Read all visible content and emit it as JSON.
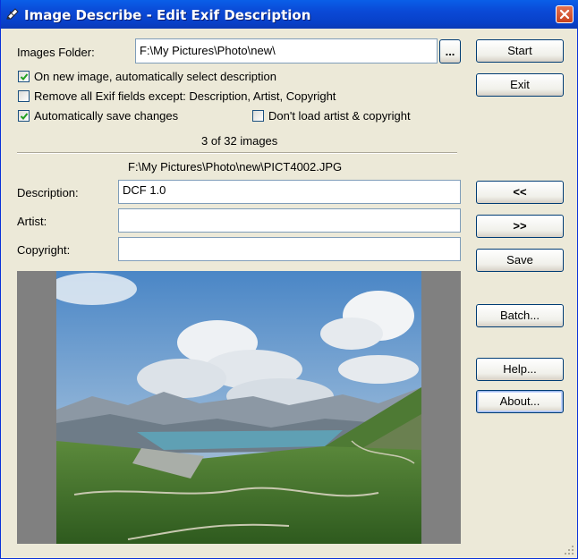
{
  "window": {
    "title": "Image Describe - Edit Exif Description"
  },
  "folder": {
    "label": "Images Folder:",
    "value": "F:\\My Pictures\\Photo\\new\\",
    "browse_label": "..."
  },
  "options": {
    "auto_select": {
      "label": "On new image, automatically select description",
      "checked": true
    },
    "remove_fields": {
      "label": "Remove all Exif fields except: Description, Artist, Copyright",
      "checked": false
    },
    "auto_save": {
      "label": "Automatically save changes",
      "checked": true
    },
    "dont_load": {
      "label": "Don't load artist & copyright",
      "checked": false
    }
  },
  "status": {
    "count_text": "3 of 32 images",
    "file_path": "F:\\My Pictures\\Photo\\new\\PICT4002.JPG"
  },
  "fields": {
    "description_label": "Description:",
    "description_value": "DCF 1.0",
    "artist_label": "Artist:",
    "artist_value": "",
    "copyright_label": "Copyright:",
    "copyright_value": ""
  },
  "buttons": {
    "start": "Start",
    "exit": "Exit",
    "prev": "<<",
    "next": ">>",
    "save": "Save",
    "batch": "Batch...",
    "help": "Help...",
    "about": "About..."
  },
  "colors": {
    "title_bar": "#0A49D6",
    "window_bg": "#ECE9D8",
    "close_button": "#C8421E"
  }
}
